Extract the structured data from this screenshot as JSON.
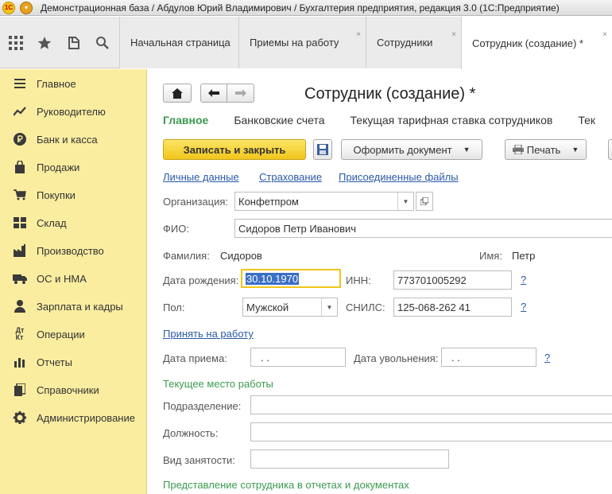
{
  "titlebar": {
    "title": "Демонстрационная база / Абдулов Юрий Владимирович / Бухгалтерия предприятия, редакция 3.0  (1С:Предприятие)",
    "logo": "1С"
  },
  "tabs": [
    {
      "label": "Начальная страница",
      "closable": false
    },
    {
      "label": "Приемы на работу",
      "closable": true
    },
    {
      "label": "Сотрудники",
      "closable": true
    },
    {
      "label": "Сотрудник (создание) *",
      "closable": true,
      "active": true
    }
  ],
  "tab_close_glyph": "×",
  "sidebar": {
    "items": [
      {
        "label": "Главное",
        "icon": "menu-lines-icon"
      },
      {
        "label": "Руководителю",
        "icon": "trend-chart-icon"
      },
      {
        "label": "Банк и касса",
        "icon": "ruble-coin-icon"
      },
      {
        "label": "Продажи",
        "icon": "shopping-bag-icon"
      },
      {
        "label": "Покупки",
        "icon": "shopping-cart-icon"
      },
      {
        "label": "Склад",
        "icon": "warehouse-icon"
      },
      {
        "label": "Производство",
        "icon": "factory-icon"
      },
      {
        "label": "ОС и НМА",
        "icon": "truck-icon"
      },
      {
        "label": "Зарплата и кадры",
        "icon": "person-icon"
      },
      {
        "label": "Операции",
        "icon": "debit-credit-icon"
      },
      {
        "label": "Отчеты",
        "icon": "bar-chart-icon"
      },
      {
        "label": "Справочники",
        "icon": "books-icon"
      },
      {
        "label": "Администрирование",
        "icon": "gear-icon"
      }
    ]
  },
  "form": {
    "title": "Сотрудник (создание) *",
    "subtabs": [
      "Главное",
      "Банковские счета",
      "Текущая тарифная ставка сотрудников",
      "Тек"
    ],
    "buttons": {
      "save_close": "Записать и закрыть",
      "create_doc": "Оформить документ",
      "print": "Печать"
    },
    "links": [
      "Личные данные",
      "Страхование",
      "Присоединенные файлы"
    ],
    "organization_label": "Организация:",
    "organization_value": "Конфетпром",
    "fio_label": "ФИО:",
    "fio_value": "Сидоров Петр Иванович",
    "surname_label": "Фамилия:",
    "surname_value": "Сидоров",
    "name_label": "Имя:",
    "name_value": "Петр",
    "birth_label": "Дата рождения:",
    "birth_value": "30.10.1970",
    "inn_label": "ИНН:",
    "inn_value": "773701005292",
    "gender_label": "Пол:",
    "gender_value": "Мужской",
    "snils_label": "СНИЛС:",
    "snils_value": "125-068-262 41",
    "help": "?",
    "hire_link": "Принять на работу",
    "hire_date_label": "Дата приема:",
    "hire_date_value": " .  .",
    "dismiss_date_label": "Дата увольнения:",
    "dismiss_date_value": " .  .",
    "current_job_header": "Текущее место работы",
    "department_label": "Подразделение:",
    "position_label": "Должность:",
    "employment_label": "Вид занятости:",
    "presentation_header": "Представление сотрудника в отчетах и документах"
  },
  "colors": {
    "sidebar_bg": "#fbeda0",
    "primary_button": "#f1c61b",
    "active_subtab": "#3c9a4f",
    "link": "#2a5aa8"
  }
}
